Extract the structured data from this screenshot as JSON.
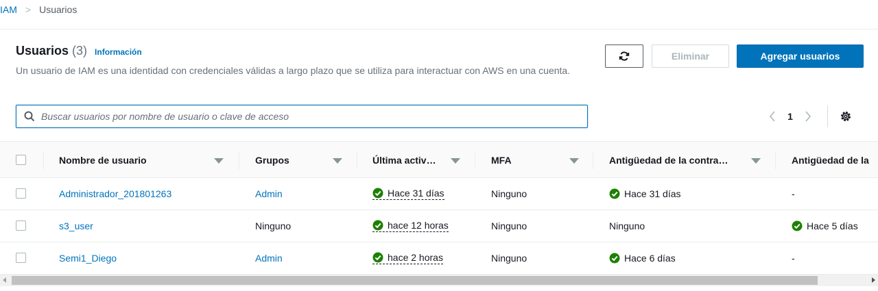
{
  "breadcrumb": {
    "root": "IAM",
    "separator": ">",
    "current": "Usuarios"
  },
  "header": {
    "title": "Usuarios",
    "count": "(3)",
    "info_link": "Información",
    "description": "Un usuario de IAM es una identidad con credenciales válidas a largo plazo que se utiliza para interactuar con AWS en una cuenta."
  },
  "toolbar": {
    "refresh_icon": "refresh-icon",
    "delete_label": "Eliminar",
    "add_label": "Agregar usuarios"
  },
  "search": {
    "placeholder": "Buscar usuarios por nombre de usuario o clave de acceso",
    "value": ""
  },
  "pagination": {
    "current_page": "1",
    "prev_icon": "chevron-left-icon",
    "next_icon": "chevron-right-icon",
    "settings_icon": "gear-icon"
  },
  "table": {
    "columns": [
      {
        "label": "Nombre de usuario"
      },
      {
        "label": "Grupos"
      },
      {
        "label": "Última activ…"
      },
      {
        "label": "MFA"
      },
      {
        "label": "Antigüedad de la contra…"
      },
      {
        "label": "Antigüedad de la"
      }
    ],
    "rows": [
      {
        "username": "Administrador_201801263",
        "groups": "Admin",
        "groups_link": true,
        "last_activity": "Hace 31 días",
        "mfa": "Ninguno",
        "password_age": "Hace 31 días",
        "password_age_ok": true,
        "key_age": "-",
        "key_age_ok": false
      },
      {
        "username": "s3_user",
        "groups": "Ninguno",
        "groups_link": false,
        "last_activity": "hace 12 horas",
        "mfa": "Ninguno",
        "password_age": "Ninguno",
        "password_age_ok": false,
        "key_age": "Hace 5 días",
        "key_age_ok": true
      },
      {
        "username": "Semi1_Diego",
        "groups": "Admin",
        "groups_link": true,
        "last_activity": "hace 2 horas",
        "mfa": "Ninguno",
        "password_age": "Hace 6 días",
        "password_age_ok": true,
        "key_age": "-",
        "key_age_ok": false
      }
    ]
  },
  "colors": {
    "link": "#0073bb",
    "primary": "#0073bb",
    "success": "#1d8102",
    "text": "#16191f",
    "muted": "#687078"
  }
}
